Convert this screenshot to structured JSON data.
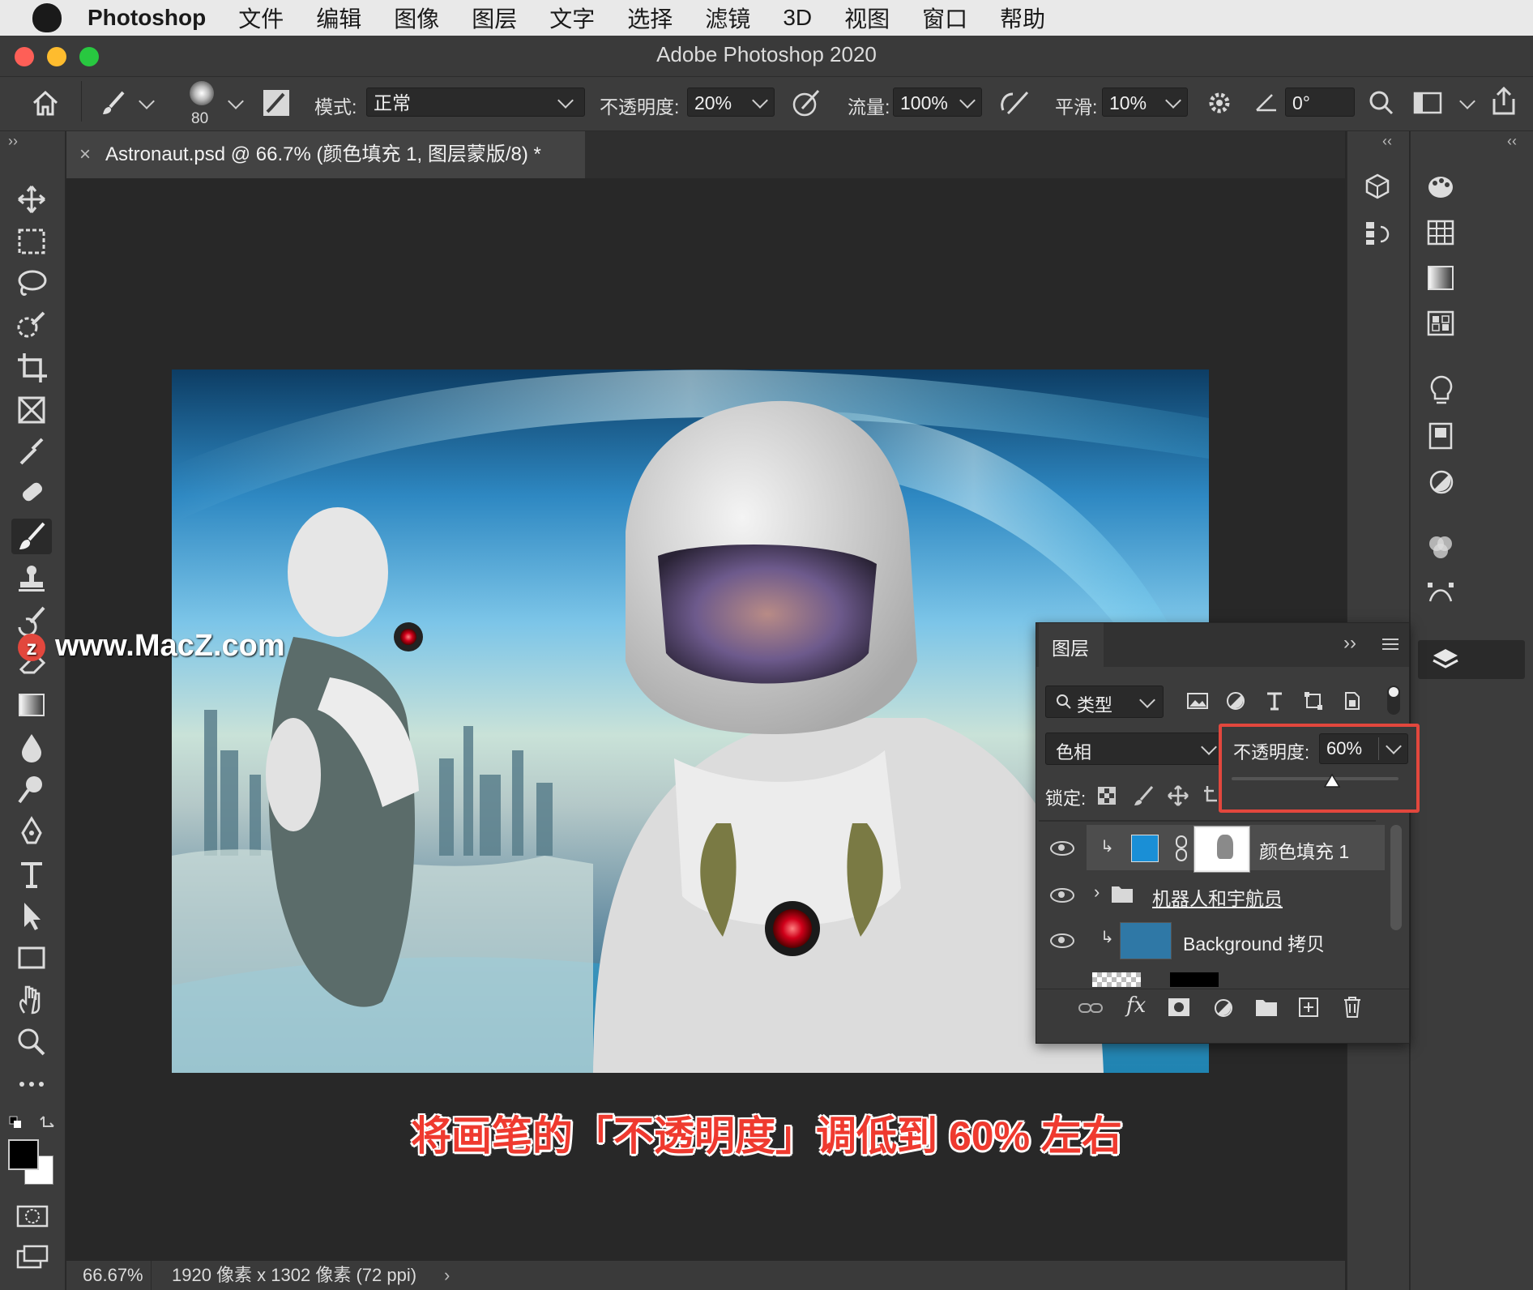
{
  "menubar": {
    "app_name": "Photoshop",
    "items": [
      "文件",
      "编辑",
      "图像",
      "图层",
      "文字",
      "选择",
      "滤镜",
      "3D",
      "视图",
      "窗口",
      "帮助"
    ]
  },
  "window": {
    "title": "Adobe Photoshop 2020"
  },
  "options_bar": {
    "brush_size": "80",
    "mode_label": "模式:",
    "mode_value": "正常",
    "opacity_label": "不透明度:",
    "opacity_value": "20%",
    "flow_label": "流量:",
    "flow_value": "100%",
    "smoothing_label": "平滑:",
    "smoothing_value": "10%",
    "angle_value": "0°"
  },
  "document_tab": {
    "title": "Astronaut.psd @ 66.7% (颜色填充 1, 图层蒙版/8) *"
  },
  "status_bar": {
    "zoom": "66.67%",
    "doc_info": "1920 像素 x 1302 像素 (72 ppi)"
  },
  "watermark": "www.MacZ.com",
  "caption": "将画笔的「不透明度」调低到 60% 左右",
  "layers_panel": {
    "tab_label": "图层",
    "filter_kind": "类型",
    "blend_mode": "色相",
    "lock_label": "锁定:",
    "opacity_popup_label": "不透明度:",
    "opacity_popup_value": "60%",
    "opacity_slider_level": 0.6,
    "layers": [
      {
        "name": "颜色填充 1",
        "swatch": "#1a8fd6"
      },
      {
        "name": "机器人和宇航员",
        "type": "group"
      },
      {
        "name": "Background 拷贝",
        "swatch": "#2f78a6"
      }
    ]
  },
  "colors": {
    "accent_red": "#e2473d",
    "ui_bg": "#3c3c3c",
    "canvas_bg": "#282828"
  }
}
